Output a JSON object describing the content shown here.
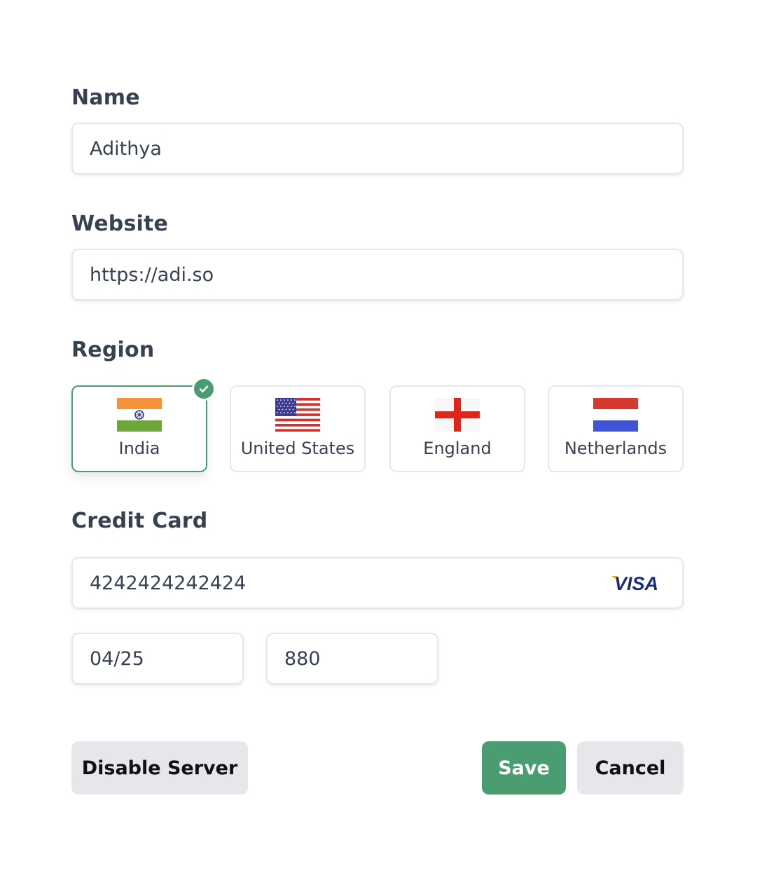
{
  "fields": {
    "name": {
      "label": "Name",
      "value": "Adithya"
    },
    "website": {
      "label": "Website",
      "value": "https://adi.so"
    },
    "region": {
      "label": "Region",
      "selected": "India",
      "options": [
        {
          "name": "India",
          "flag": "india-flag-icon"
        },
        {
          "name": "United States",
          "flag": "us-flag-icon"
        },
        {
          "name": "England",
          "flag": "england-flag-icon"
        },
        {
          "name": "Netherlands",
          "flag": "netherlands-flag-icon"
        }
      ]
    },
    "credit_card": {
      "label": "Credit Card",
      "number": "4242424242424",
      "brand": "VISA",
      "expiry": "04/25",
      "cvc": "880"
    }
  },
  "actions": {
    "disable_server": "Disable Server",
    "save": "Save",
    "cancel": "Cancel"
  },
  "colors": {
    "accent": "#4a9d71",
    "button_gray": "#e5e7eb",
    "text": "#374151",
    "border": "#e5e7eb"
  }
}
